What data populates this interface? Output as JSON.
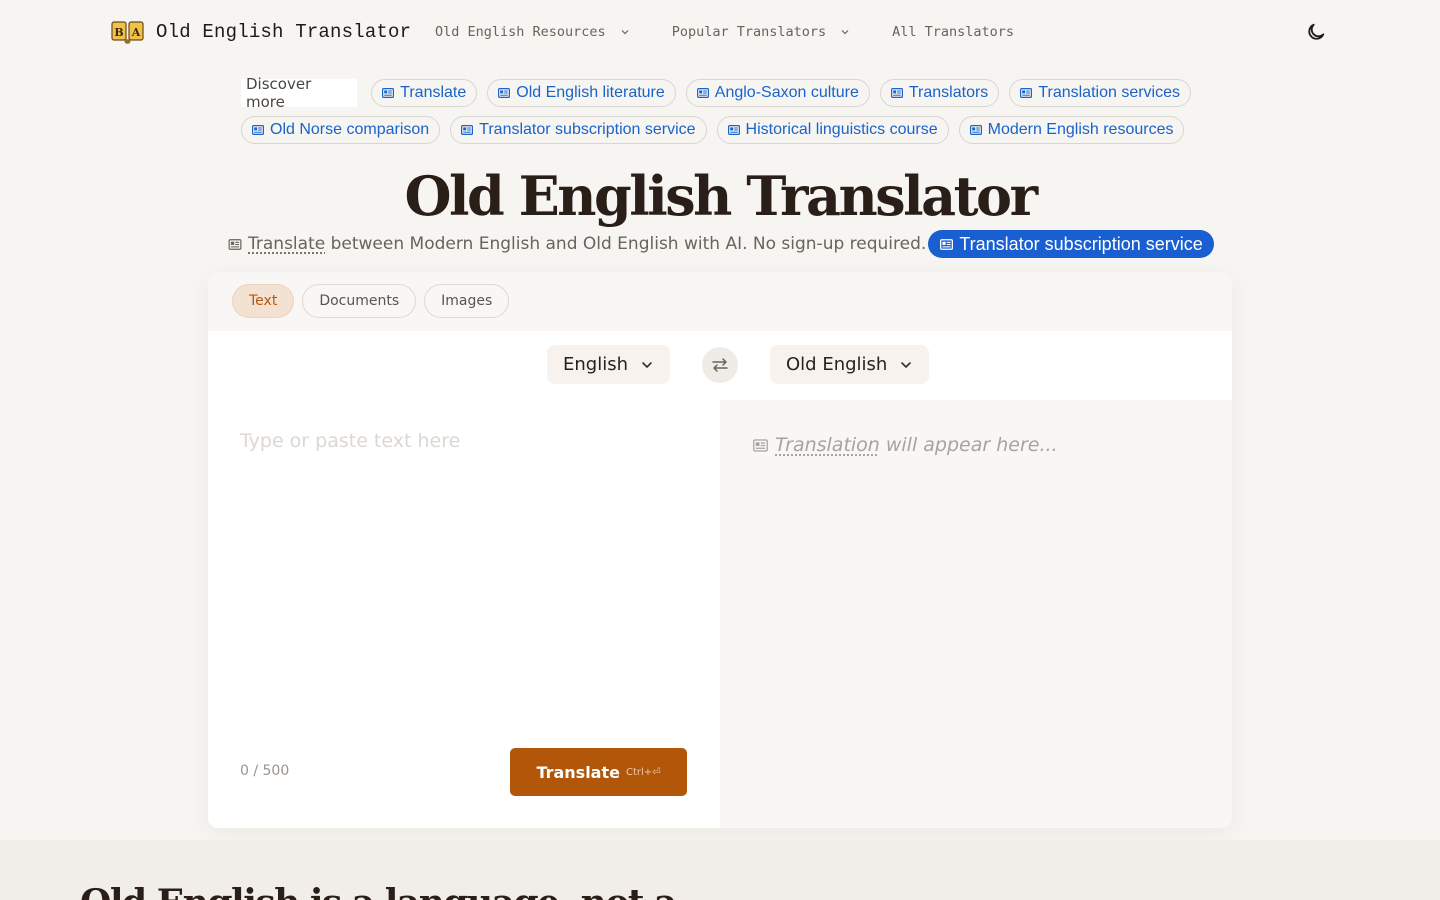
{
  "brand": {
    "name": "Old English Translator"
  },
  "nav": {
    "items": [
      {
        "label": "Old English Resources",
        "has_menu": true
      },
      {
        "label": "Popular Translators",
        "has_menu": true
      },
      {
        "label": "All Translators",
        "has_menu": false
      }
    ],
    "theme_icon": "moon-icon"
  },
  "discover": {
    "label": "Discover more",
    "chips": [
      {
        "label": "Translate"
      },
      {
        "label": "Old English literature"
      },
      {
        "label": "Anglo-Saxon culture"
      },
      {
        "label": "Translators"
      },
      {
        "label": "Translation services"
      },
      {
        "label": "Old Norse comparison"
      },
      {
        "label": "Translator subscription service"
      },
      {
        "label": "Historical linguistics course"
      },
      {
        "label": "Modern English resources"
      }
    ]
  },
  "hero": {
    "title": "Old English Translator",
    "sub_link": "Translate",
    "sub_text": "between Modern English and Old English with AI. No sign-up required.",
    "cta": "Translator subscription service"
  },
  "translator": {
    "tabs": [
      {
        "label": "Text",
        "active": true
      },
      {
        "label": "Documents",
        "active": false
      },
      {
        "label": "Images",
        "active": false
      }
    ],
    "source_lang": "English",
    "target_lang": "Old English",
    "input_placeholder": "Type or paste text here",
    "input_value": "",
    "counter": "0 / 500",
    "translate_label": "Translate",
    "shortcut": "Ctrl+⏎",
    "output_link": "Translation",
    "output_placeholder": "will appear here..."
  },
  "below": {
    "heading": "Old English is a language, not a"
  },
  "colors": {
    "accent": "#b25609",
    "link": "#1a63c9",
    "cta": "#1a5fd1",
    "background": "#f7f5f2"
  }
}
